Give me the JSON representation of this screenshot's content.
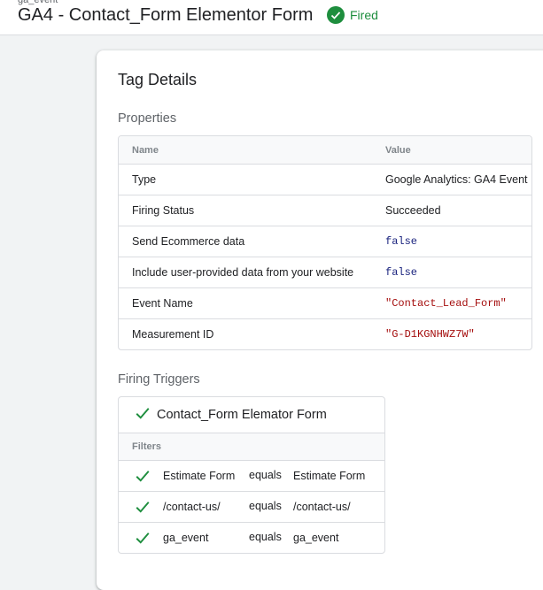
{
  "header": {
    "crumb": "ga_event",
    "title": "GA4 - Contact_Form Elementor Form",
    "status": "Fired",
    "status_color": "#1e8e3e",
    "status_icon": "check-circle-icon"
  },
  "details": {
    "title": "Tag Details",
    "properties": {
      "title": "Properties",
      "columns": {
        "name": "Name",
        "value": "Value"
      },
      "rows": [
        {
          "name": "Type",
          "value": "Google Analytics: GA4 Event",
          "kind": "text"
        },
        {
          "name": "Firing Status",
          "value": "Succeeded",
          "kind": "text"
        },
        {
          "name": "Send Ecommerce data",
          "value": "false",
          "kind": "bool"
        },
        {
          "name": "Include user-provided data from your website",
          "value": "false",
          "kind": "bool"
        },
        {
          "name": "Event Name",
          "value": "\"Contact_Lead_Form\"",
          "kind": "string"
        },
        {
          "name": "Measurement ID",
          "value": "\"G-D1KGNHWZ7W\"",
          "kind": "string"
        }
      ]
    },
    "firing_triggers": {
      "title": "Firing Triggers",
      "trigger": {
        "name": "Contact_Form Elemator Form",
        "icon": "check-icon"
      },
      "filters_label": "Filters",
      "filters": [
        {
          "variable": "Estimate Form",
          "operator": "equals",
          "value": "Estimate Form"
        },
        {
          "variable": "/contact-us/",
          "operator": "equals",
          "value": "/contact-us/"
        },
        {
          "variable": "ga_event",
          "operator": "equals",
          "value": "ga_event"
        }
      ]
    }
  },
  "colors": {
    "success": "#1e8e3e",
    "bool": "#1a237e",
    "string": "#a50e0e"
  }
}
